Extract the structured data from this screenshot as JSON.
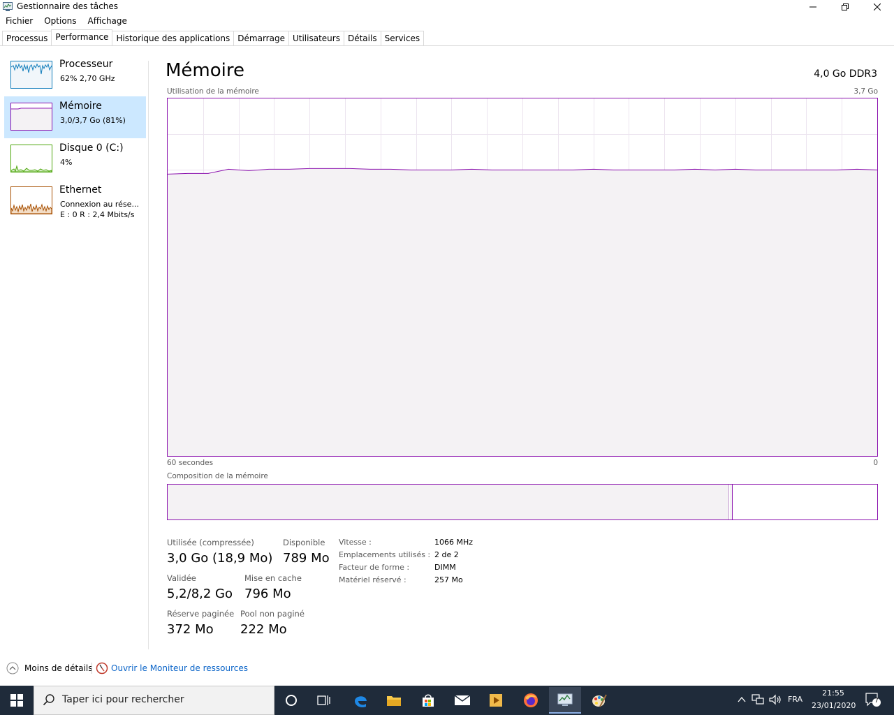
{
  "window": {
    "title": "Gestionnaire des tâches",
    "controls": {
      "minimize": "—",
      "maximize": "❐",
      "close": "✕"
    }
  },
  "menu": [
    "Fichier",
    "Options",
    "Affichage"
  ],
  "tabs": [
    "Processus",
    "Performance",
    "Historique des applications",
    "Démarrage",
    "Utilisateurs",
    "Détails",
    "Services"
  ],
  "active_tab": "Performance",
  "sidebar": {
    "items": [
      {
        "name": "Processeur",
        "sub1": "62%  2,70 GHz",
        "sub2": "",
        "color": "#117dbb"
      },
      {
        "name": "Mémoire",
        "sub1": "3,0/3,7 Go (81%)",
        "sub2": "",
        "color": "#8b12ae"
      },
      {
        "name": "Disque 0 (C:)",
        "sub1": "4%",
        "sub2": "",
        "color": "#4da60c"
      },
      {
        "name": "Ethernet",
        "sub1": "Connexion au rése...",
        "sub2": "E : 0  R : 2,4 Mbits/s",
        "color": "#a74f01"
      }
    ]
  },
  "main": {
    "title": "Mémoire",
    "spec": "4,0 Go DDR3",
    "usage_label": "Utilisation de la mémoire",
    "usage_max": "3,7 Go",
    "time_left": "60 secondes",
    "time_right": "0",
    "composition_label": "Composition de la mémoire",
    "usage_fraction": 0.8
  },
  "stats": {
    "used_label": "Utilisée (compressée)",
    "used_value": "3,0 Go (18,9 Mo)",
    "available_label": "Disponible",
    "available_value": "789 Mo",
    "committed_label": "Validée",
    "committed_value": "5,2/8,2 Go",
    "cached_label": "Mise en cache",
    "cached_value": "796 Mo",
    "paged_label": "Réserve paginée",
    "paged_value": "372 Mo",
    "nonpaged_label": "Pool non paginé",
    "nonpaged_value": "222 Mo"
  },
  "specs": [
    {
      "label": "Vitesse :",
      "value": "1066 MHz"
    },
    {
      "label": "Emplacements utilisés :",
      "value": "2 de 2"
    },
    {
      "label": "Facteur de forme :",
      "value": "DIMM"
    },
    {
      "label": "Matériel réservé :",
      "value": "257 Mo"
    }
  ],
  "footer": {
    "less_details": "Moins de détails",
    "resource_monitor": "Ouvrir le Moniteur de ressources"
  },
  "taskbar": {
    "search_placeholder": "Taper ici pour rechercher",
    "lang": "FRA",
    "time": "21:55",
    "date": "23/01/2020",
    "notifications": "7"
  }
}
